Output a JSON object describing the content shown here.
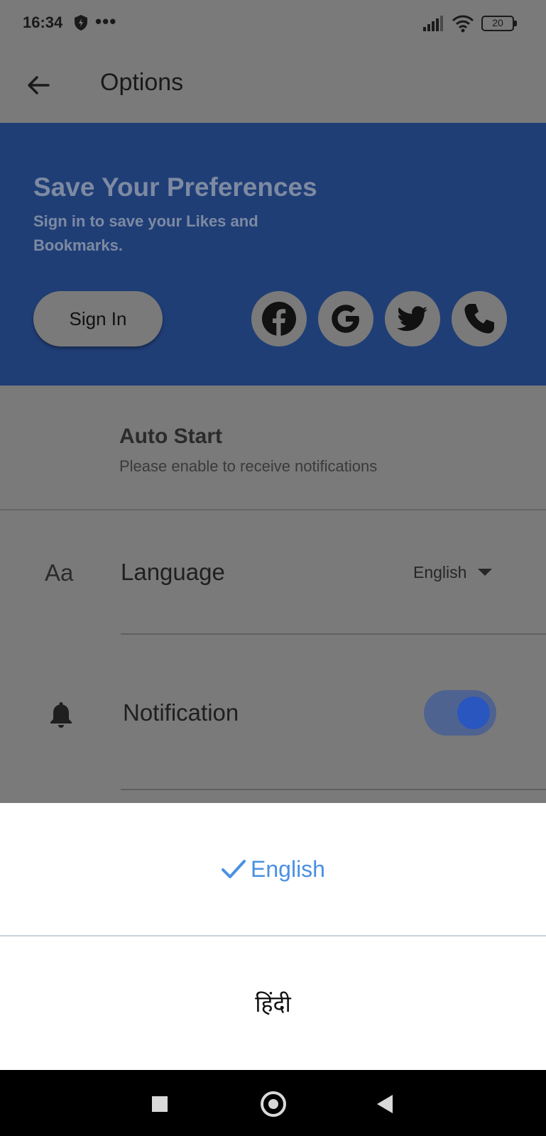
{
  "status_bar": {
    "time": "16:34",
    "more": "•••",
    "battery": "20",
    "icons": [
      "shield-icon",
      "signal-icon",
      "wifi-icon",
      "battery-icon"
    ]
  },
  "app_bar": {
    "title": "Options",
    "back_icon": "arrow-left-icon"
  },
  "banner": {
    "title": "Save Your Preferences",
    "subtitle": "Sign in to save your Likes and Bookmarks.",
    "sign_in_label": "Sign In",
    "social_icons": [
      "facebook-icon",
      "google-icon",
      "twitter-icon",
      "phone-icon"
    ],
    "background": "#203e76"
  },
  "auto_start": {
    "title": "Auto Start",
    "subtitle": "Please enable to receive notifications"
  },
  "language": {
    "icon_text": "Aa",
    "label": "Language",
    "selected": "English"
  },
  "notification": {
    "label": "Notification",
    "enabled": true,
    "icon": "bell-icon"
  },
  "language_sheet": {
    "options": [
      {
        "label": "English",
        "selected": true
      },
      {
        "label": "हिंदी",
        "selected": false
      }
    ],
    "accent": "#4a90e2"
  },
  "nav_bar": {
    "icons": [
      "recents-icon",
      "home-icon",
      "back-icon"
    ]
  }
}
